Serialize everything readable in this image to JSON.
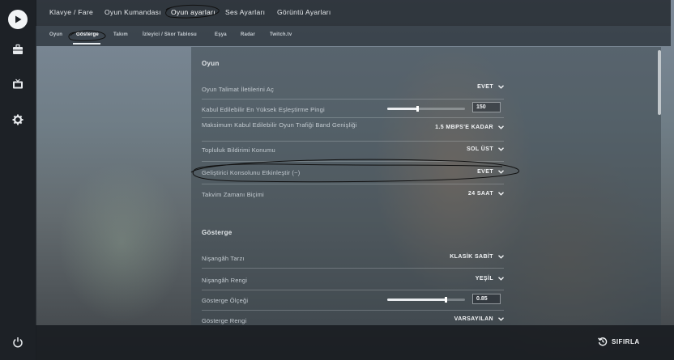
{
  "sidebar": {
    "icons": [
      "play-icon",
      "briefcase-icon",
      "tv-icon",
      "gear-icon",
      "power-icon"
    ]
  },
  "top_tabs": [
    {
      "label": "Klavye / Fare"
    },
    {
      "label": "Oyun Kumandası"
    },
    {
      "label": "Oyun ayarları",
      "active": true
    },
    {
      "label": "Ses Ayarları"
    },
    {
      "label": "Görüntü Ayarları"
    }
  ],
  "sub_tabs": [
    {
      "label": "Oyun"
    },
    {
      "label": "Gösterge",
      "active": true
    },
    {
      "label": "Takım"
    },
    {
      "label": "İzleyici / Skor Tablosu"
    },
    {
      "label": "Eşya"
    },
    {
      "label": "Radar"
    },
    {
      "label": "Twitch.tv"
    }
  ],
  "sections": {
    "oyun": {
      "title": "Oyun",
      "rows": [
        {
          "label": "Oyun Talimat İletilerini Aç",
          "value": "EVET"
        },
        {
          "label": "Kabul Edilebilir En Yüksek Eşleştirme Pingi",
          "value": "150",
          "slider_fraction": 0.39
        },
        {
          "label": "Maksimum Kabul Edilebilir Oyun Trafiği Band Genişliği",
          "value": "1.5 MBPS'E KADAR"
        },
        {
          "label": "Topluluk Bildirimi Konumu",
          "value": "SOL ÜST"
        },
        {
          "label": "Geliştirici Konsolunu Etkinleştir (~)",
          "value": "EVET"
        },
        {
          "label": "Takvim Zamanı Biçimi",
          "value": "24 SAAT"
        }
      ]
    },
    "gosterge": {
      "title": "Gösterge",
      "rows": [
        {
          "label": "Nişangâh Tarzı",
          "value": "KLASİK SABİT"
        },
        {
          "label": "Nişangâh Rengi",
          "value": "YEŞİL"
        },
        {
          "label": "Gösterge Ölçeği",
          "value": "0.85",
          "slider_fraction": 0.75
        },
        {
          "label": "Gösterge Rengi",
          "value": "VARSAYILAN"
        }
      ]
    }
  },
  "bottom": {
    "reset_label": "SIFIRLA"
  }
}
